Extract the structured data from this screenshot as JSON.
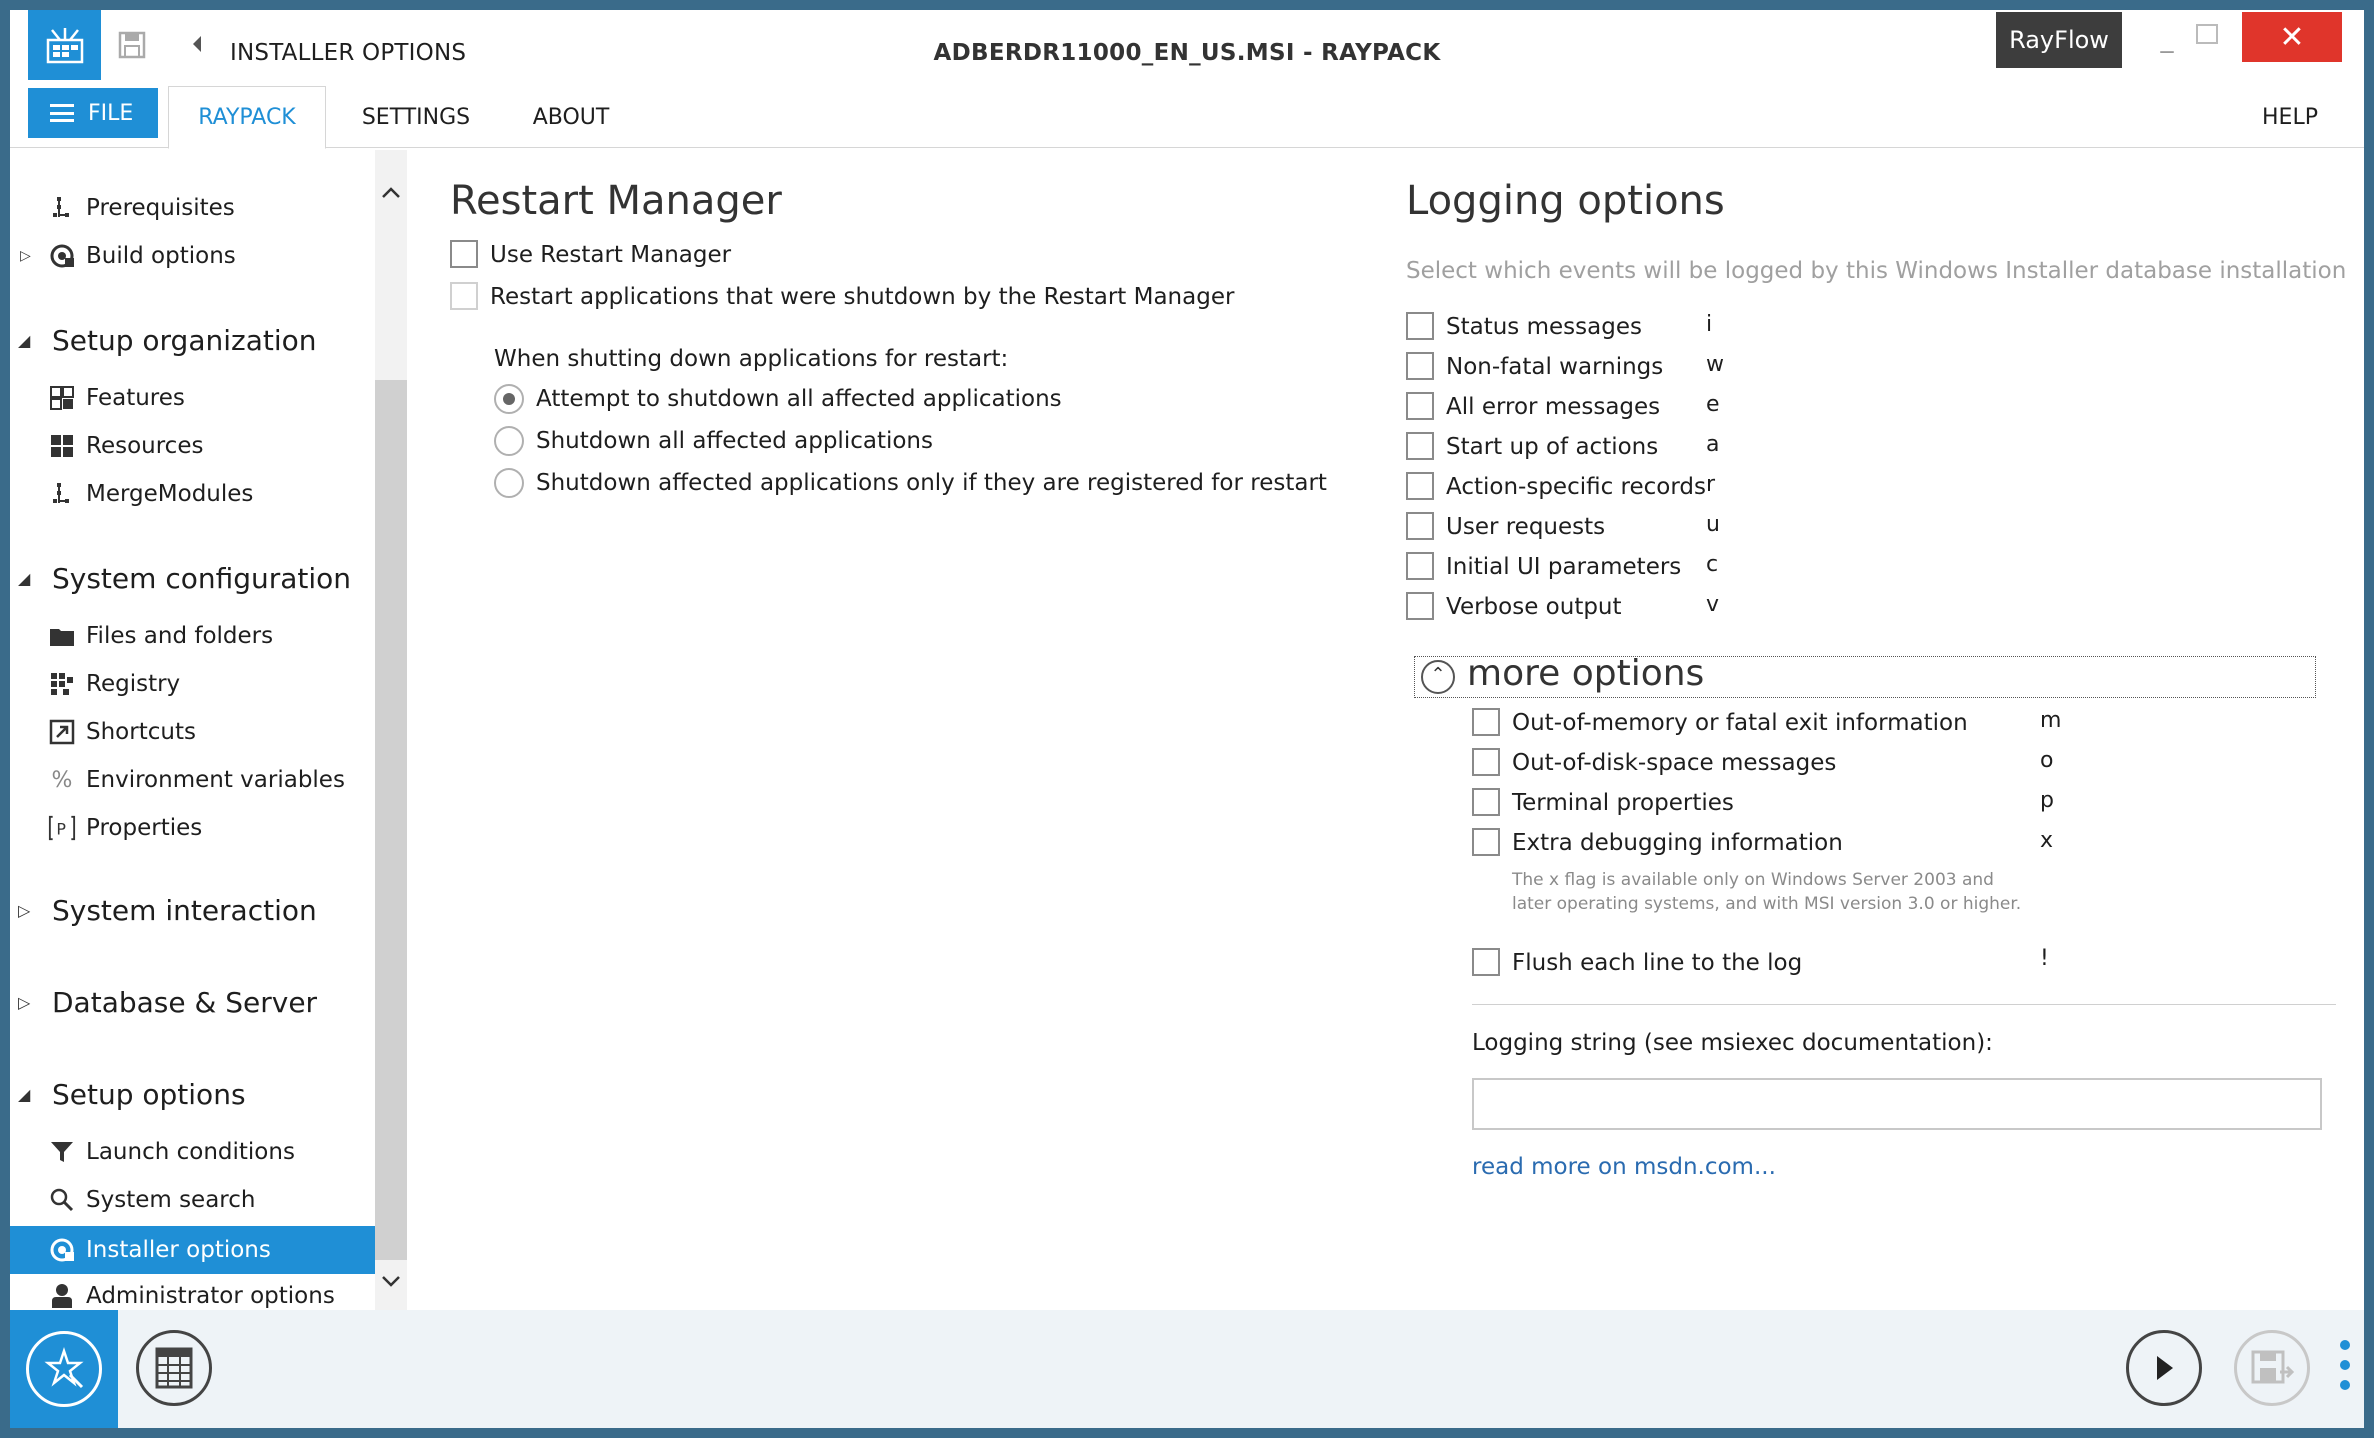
{
  "titlebar": {
    "window_title": "INSTALLER OPTIONS",
    "document_title": "ADBERDR11000_EN_US.MSI - RAYPACK",
    "rayflow_label": "RayFlow",
    "close_glyph": "✕"
  },
  "ribbon": {
    "file_label": "FILE",
    "tabs": [
      "RAYPACK",
      "SETTINGS",
      "ABOUT"
    ],
    "help_label": "HELP"
  },
  "sidebar": {
    "top_items": [
      {
        "label": "Prerequisites",
        "icon": "prerequisites-icon"
      },
      {
        "label": "Build options",
        "icon": "build-options-icon"
      }
    ],
    "groups": [
      {
        "label": "Setup organization",
        "items": [
          {
            "label": "Features",
            "icon": "features-icon"
          },
          {
            "label": "Resources",
            "icon": "resources-icon"
          },
          {
            "label": "MergeModules",
            "icon": "merge-modules-icon"
          }
        ]
      },
      {
        "label": "System configuration",
        "items": [
          {
            "label": "Files and folders",
            "icon": "folder-icon"
          },
          {
            "label": "Registry",
            "icon": "registry-icon"
          },
          {
            "label": "Shortcuts",
            "icon": "shortcut-icon"
          },
          {
            "label": "Environment variables",
            "icon": "percent-icon"
          },
          {
            "label": "Properties",
            "icon": "properties-icon"
          }
        ]
      },
      {
        "label": "System interaction",
        "items": []
      },
      {
        "label": "Database & Server",
        "items": []
      },
      {
        "label": "Setup options",
        "items": [
          {
            "label": "Launch conditions",
            "icon": "filter-icon"
          },
          {
            "label": "System search",
            "icon": "search-icon"
          },
          {
            "label": "Installer options",
            "icon": "installer-options-icon",
            "selected": true
          },
          {
            "label": "Administrator options",
            "icon": "administrator-icon"
          }
        ]
      }
    ]
  },
  "restart_manager": {
    "heading": "Restart Manager",
    "use_label": "Use Restart Manager",
    "restart_apps_label": "Restart applications that were shutdown by the Restart Manager",
    "shutdown_prompt": "When shutting down applications for restart:",
    "radio_options": [
      {
        "label": "Attempt to shutdown all affected applications",
        "checked": true
      },
      {
        "label": "Shutdown all affected applications",
        "checked": false
      },
      {
        "label": "Shutdown affected applications only if they are registered for restart",
        "checked": false
      }
    ]
  },
  "logging": {
    "heading": "Logging options",
    "description": "Select which events will be logged by this Windows Installer database installation",
    "options": [
      {
        "label": "Status messages",
        "flag": "i"
      },
      {
        "label": "Non-fatal warnings",
        "flag": "w"
      },
      {
        "label": "All error messages",
        "flag": "e"
      },
      {
        "label": "Start up of actions",
        "flag": "a"
      },
      {
        "label": "Action-specific records",
        "flag": "r"
      },
      {
        "label": "User requests",
        "flag": "u"
      },
      {
        "label": "Initial UI parameters",
        "flag": "c"
      },
      {
        "label": "Verbose output",
        "flag": "v"
      }
    ],
    "more_options_label": "more options",
    "more_options_glyph": "⌃",
    "more": [
      {
        "label": "Out-of-memory or fatal exit information",
        "flag": "m"
      },
      {
        "label": "Out-of-disk-space messages",
        "flag": "o"
      },
      {
        "label": "Terminal properties",
        "flag": "p"
      },
      {
        "label": "Extra debugging information",
        "flag": "x"
      }
    ],
    "x_flag_note": "The x flag is available only on Windows Server 2003 and later operating systems, and with MSI version 3.0 or higher.",
    "flush_label": "Flush each line to the log",
    "flush_flag": "!",
    "logging_string_label": "Logging string (see msiexec documentation):",
    "logging_string_value": "",
    "read_more_label": "read more on msdn.com..."
  },
  "colors": {
    "accent": "#1f8fd6",
    "close": "#e0352b",
    "rayflow": "#3d3d3d",
    "link": "#2a6bb0"
  }
}
